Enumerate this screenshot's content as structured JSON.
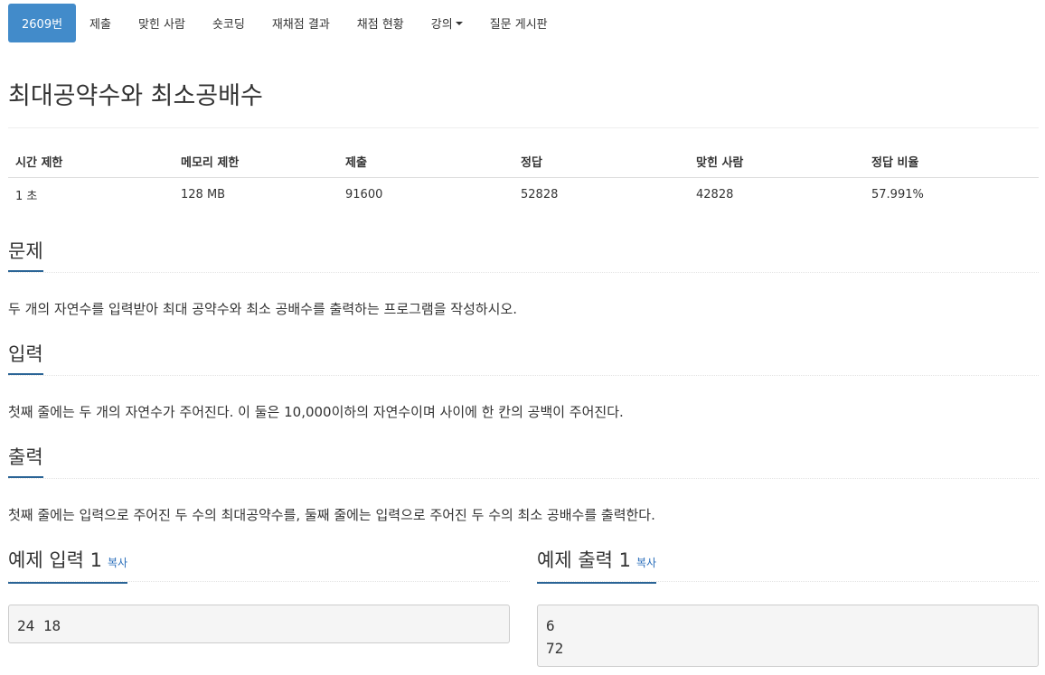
{
  "nav": {
    "items": [
      {
        "label": "2609번",
        "active": true
      },
      {
        "label": "제출"
      },
      {
        "label": "맞힌 사람"
      },
      {
        "label": "숏코딩"
      },
      {
        "label": "재채점 결과"
      },
      {
        "label": "채점 현황"
      },
      {
        "label": "강의",
        "dropdown": true
      },
      {
        "label": "질문 게시판"
      }
    ]
  },
  "problem": {
    "title": "최대공약수와 최소공배수"
  },
  "stats": {
    "headers": [
      "시간 제한",
      "메모리 제한",
      "제출",
      "정답",
      "맞힌 사람",
      "정답 비율"
    ],
    "values": [
      "1 초",
      "128 MB",
      "91600",
      "52828",
      "42828",
      "57.991%"
    ]
  },
  "sections": {
    "description": {
      "heading": "문제",
      "text": "두 개의 자연수를 입력받아 최대 공약수와 최소 공배수를 출력하는 프로그램을 작성하시오."
    },
    "input": {
      "heading": "입력",
      "text": "첫째 줄에는 두 개의 자연수가 주어진다. 이 둘은 10,000이하의 자연수이며 사이에 한 칸의 공백이 주어진다."
    },
    "output": {
      "heading": "출력",
      "text": "첫째 줄에는 입력으로 주어진 두 수의 최대공약수를, 둘째 줄에는 입력으로 주어진 두 수의 최소 공배수를 출력한다."
    }
  },
  "samples": {
    "input": {
      "heading": "예제 입력 1",
      "copy_label": "복사",
      "content": "24 18"
    },
    "output": {
      "heading": "예제 출력 1",
      "copy_label": "복사",
      "content": "6\n72"
    }
  },
  "colors": {
    "accent": "#428bca",
    "underline": "#2a6496",
    "link": "#2a6ebb"
  }
}
